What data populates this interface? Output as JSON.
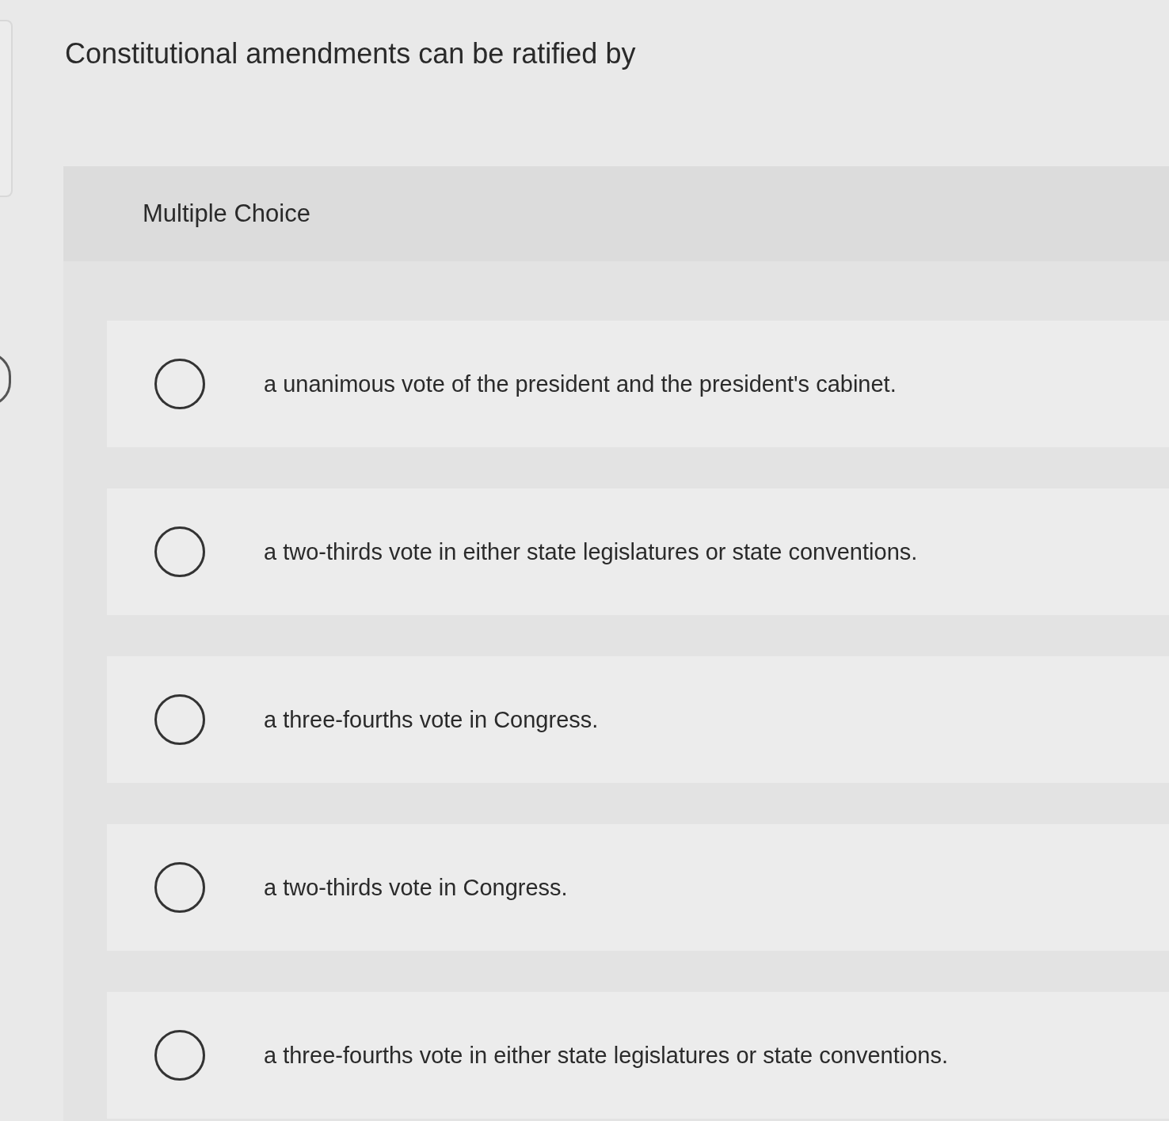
{
  "question": {
    "text": "Constitutional amendments can be ratified by"
  },
  "section": {
    "label": "Multiple Choice"
  },
  "options": [
    {
      "text": "a unanimous vote of the president and the president's cabinet.",
      "selected": false
    },
    {
      "text": "a two-thirds vote in either state legislatures or state conventions.",
      "selected": false
    },
    {
      "text": "a three-fourths vote in Congress.",
      "selected": false
    },
    {
      "text": "a two-thirds vote in Congress.",
      "selected": false
    },
    {
      "text": "a three-fourths vote in either state legislatures or state conventions.",
      "selected": false
    }
  ]
}
